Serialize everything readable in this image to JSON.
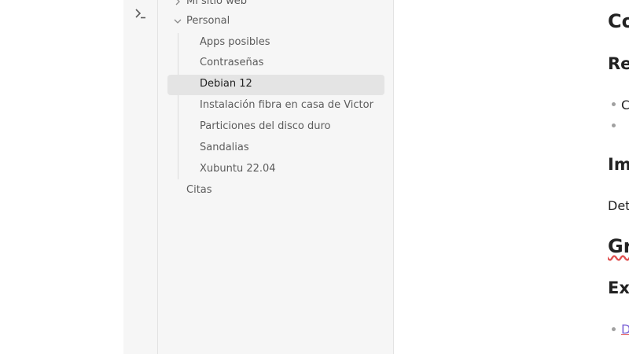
{
  "ribbon": {
    "terminal_icon": "terminal-icon"
  },
  "tree": {
    "top_partial": "Mi sitio web",
    "folder_personal": "Personal",
    "children": [
      "Apps posibles",
      "Contraseñas",
      "Debian 12",
      "Instalación fibra en casa de Victor",
      "Particiones del disco duro",
      "Sandalias",
      "Xubuntu 22.04"
    ],
    "active": "Debian 12",
    "citas": "Citas"
  },
  "editor": {
    "h1": "Co",
    "h2": "Re",
    "bullet1": "C",
    "bullet2": "",
    "h3": "Imp",
    "p1": "Det",
    "h4": "Gr",
    "h5": "Ext",
    "link1": "D"
  }
}
